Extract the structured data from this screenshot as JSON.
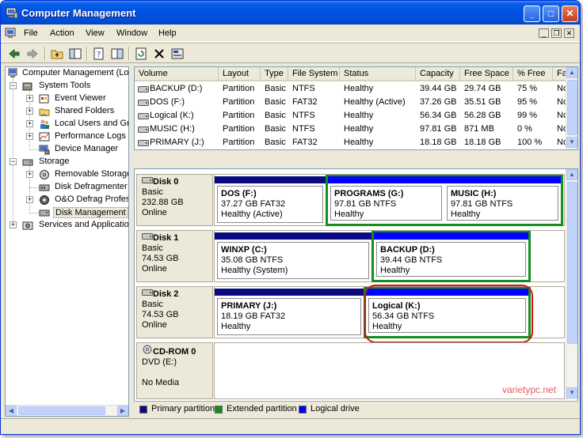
{
  "window": {
    "title": "Computer Management"
  },
  "title_buttons": {
    "minimize": "0",
    "maximize": "1",
    "close": "r"
  },
  "menu": [
    "File",
    "Action",
    "View",
    "Window",
    "Help"
  ],
  "tree": {
    "root": "Computer Management (Local)",
    "system_tools": "System Tools",
    "event_viewer": "Event Viewer",
    "shared_folders": "Shared Folders",
    "local_users": "Local Users and Groups",
    "performance_logs": "Performance Logs and Alerts",
    "device_manager": "Device Manager",
    "storage": "Storage",
    "removable_storage": "Removable Storage",
    "disk_defragmenter": "Disk Defragmenter",
    "oo_defrag": "O&O Defrag Professional",
    "disk_management": "Disk Management",
    "services": "Services and Applications"
  },
  "volume_list": {
    "columns": [
      "Volume",
      "Layout",
      "Type",
      "File System",
      "Status",
      "Capacity",
      "Free Space",
      "% Free",
      "Fault Tolerance"
    ],
    "rows": [
      [
        "BACKUP (D:)",
        "Partition",
        "Basic",
        "NTFS",
        "Healthy",
        "39.44 GB",
        "29.74 GB",
        "75 %",
        "No"
      ],
      [
        "DOS (F:)",
        "Partition",
        "Basic",
        "FAT32",
        "Healthy (Active)",
        "37.26 GB",
        "35.51 GB",
        "95 %",
        "No"
      ],
      [
        "Logical (K:)",
        "Partition",
        "Basic",
        "NTFS",
        "Healthy",
        "56.34 GB",
        "56.28 GB",
        "99 %",
        "No"
      ],
      [
        "MUSIC (H:)",
        "Partition",
        "Basic",
        "NTFS",
        "Healthy",
        "97.81 GB",
        "871 MB",
        "0 %",
        "No"
      ],
      [
        "PRIMARY (J:)",
        "Partition",
        "Basic",
        "FAT32",
        "Healthy",
        "18.18 GB",
        "18.18 GB",
        "100 %",
        "No"
      ]
    ]
  },
  "disks": [
    {
      "name": "Disk 0",
      "type": "Basic",
      "size": "232.88 GB",
      "status": "Online",
      "partitions": [
        {
          "name": "DOS  (F:)",
          "size": "37.27 GB FAT32",
          "status": "Healthy (Active)",
          "kind": "primary"
        },
        {
          "name": "PROGRAMS  (G:)",
          "size": "97.81 GB NTFS",
          "status": "Healthy",
          "kind": "logical"
        },
        {
          "name": "MUSIC  (H:)",
          "size": "97.81 GB NTFS",
          "status": "Healthy",
          "kind": "logical"
        }
      ]
    },
    {
      "name": "Disk 1",
      "type": "Basic",
      "size": "74.53 GB",
      "status": "Online",
      "partitions": [
        {
          "name": "WINXP  (C:)",
          "size": "35.08 GB NTFS",
          "status": "Healthy (System)",
          "kind": "primary"
        },
        {
          "name": "BACKUP  (D:)",
          "size": "39.44 GB NTFS",
          "status": "Healthy",
          "kind": "logical"
        }
      ]
    },
    {
      "name": "Disk 2",
      "type": "Basic",
      "size": "74.53 GB",
      "status": "Online",
      "partitions": [
        {
          "name": "PRIMARY  (J:)",
          "size": "18.19 GB FAT32",
          "status": "Healthy",
          "kind": "primary"
        },
        {
          "name": "Logical  (K:)",
          "size": "56.34 GB NTFS",
          "status": "Healthy",
          "kind": "logical"
        }
      ]
    },
    {
      "name": "CD-ROM 0",
      "type": "DVD (E:)",
      "size": "",
      "status": "No Media",
      "partitions": []
    }
  ],
  "legend": [
    {
      "label": "Primary partition",
      "color": "#0A0A80"
    },
    {
      "label": "Extended partition",
      "color": "#168E1D"
    },
    {
      "label": "Logical drive",
      "color": "#0000FF"
    }
  ],
  "colors": {
    "primary": "#0A0A80",
    "extended": "#168E1D",
    "logical": "#0000FF",
    "highlight": "#D51010"
  },
  "watermark": "varietypc.net"
}
